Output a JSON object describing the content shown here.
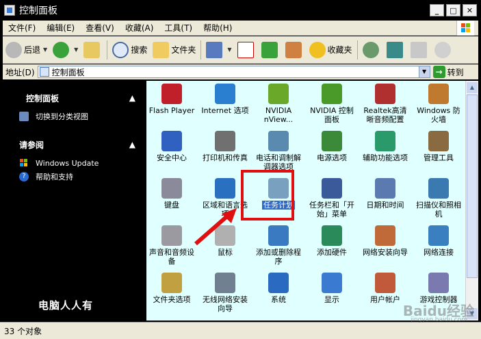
{
  "window": {
    "title": "控制面板",
    "buttons": [
      "_",
      "□",
      "✕"
    ]
  },
  "menubar": [
    "文件(F)",
    "编辑(E)",
    "查看(V)",
    "收藏(A)",
    "工具(T)",
    "帮助(H)"
  ],
  "toolbar": {
    "back": "后退",
    "search": "搜索",
    "folders": "文件夹",
    "favorites": "收藏夹"
  },
  "address": {
    "label": "地址(D)",
    "value": "控制面板",
    "go": "转到"
  },
  "sidebar": {
    "sections": [
      {
        "title": "控制面板",
        "items": [
          "切换到分类视图"
        ]
      },
      {
        "title": "请参阅",
        "items": [
          "Windows Update",
          "帮助和支持"
        ]
      }
    ],
    "watermark": "电脑人人有"
  },
  "items": [
    "Flash Player",
    "Internet 选项",
    "NVIDIA nView...",
    "NVIDIA 控制面板",
    "Realtek高清晰音频配置",
    "Windows 防火墙",
    "安全中心",
    "打印机和传真",
    "电话和调制解调器选项",
    "电源选项",
    "辅助功能选项",
    "管理工具",
    "键盘",
    "区域和语言选项",
    "任务计划",
    "任务栏和「开始」菜单",
    "日期和时间",
    "扫描仪和照相机",
    "声音和音频设备",
    "鼠标",
    "添加或删除程序",
    "添加硬件",
    "网络安装向导",
    "网络连接",
    "文件夹选项",
    "无线网络安装向导",
    "系统",
    "显示",
    "用户帐户",
    "游戏控制器"
  ],
  "item_colors": [
    "#c0202a",
    "#2a7fd0",
    "#6aa82a",
    "#4a9a2a",
    "#b03030",
    "#c07a30",
    "#3060c0",
    "#707070",
    "#5a8ab0",
    "#3a8a3a",
    "#2a9a6a",
    "#8a6a40",
    "#8a8a9a",
    "#2a70c0",
    "#7aa0c0",
    "#3a5a9a",
    "#5a7ab0",
    "#3a7ab0",
    "#9a9aa0",
    "#b0b0b0",
    "#3a7ac0",
    "#2a8a5a",
    "#c06a3a",
    "#3a80c0",
    "#c0a040",
    "#708090",
    "#2a6ac0",
    "#3a7ad0",
    "#c05a3a",
    "#7a7ab0"
  ],
  "selected_item": "任务计划",
  "status": "33 个对象",
  "watermark": {
    "text": "Baidu经验",
    "sub": "jingyan.baidu.com"
  }
}
